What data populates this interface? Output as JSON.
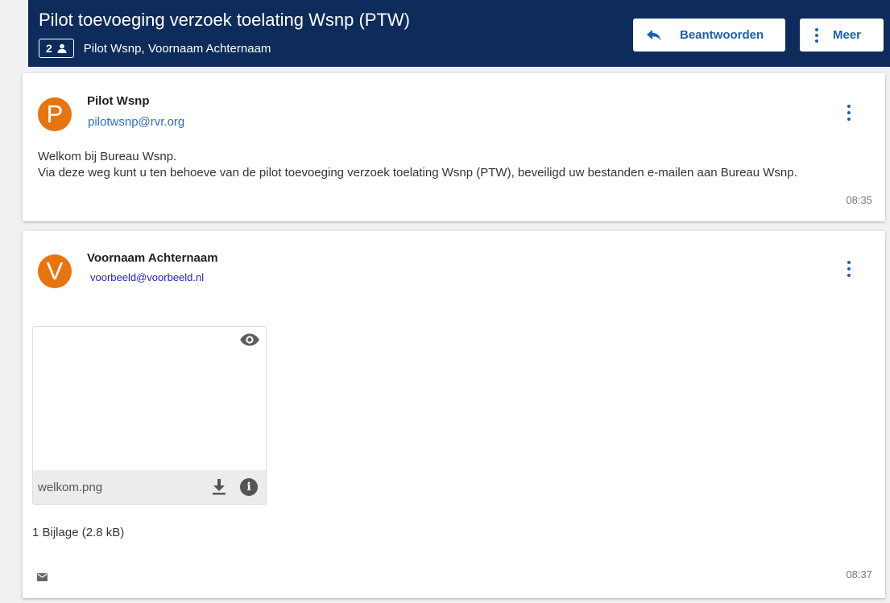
{
  "header": {
    "subject": "Pilot toevoeging verzoek toelating Wsnp (PTW)",
    "participant_count": "2",
    "participants": "Pilot Wsnp, Voornaam Achternaam",
    "reply_label": "Beantwoorden",
    "more_label": "Meer"
  },
  "messages": [
    {
      "avatar_letter": "P",
      "sender_name": "Pilot Wsnp",
      "sender_email": "pilotwsnp@rvr.org",
      "body_line1": "Welkom bij Bureau Wsnp.",
      "body_line2": "Via deze weg kunt u ten behoeve van de pilot toevoeging verzoek toelating Wsnp (PTW), beveiligd uw bestanden e-mailen aan Bureau Wsnp.",
      "time": "08:35"
    },
    {
      "avatar_letter": "V",
      "sender_name": "Voornaam Achternaam",
      "sender_email": "voorbeeld@voorbeeld.nl",
      "attachment_name": "welkom.png",
      "attachment_summary": "1 Bijlage (2.8 kB)",
      "time": "08:37"
    }
  ],
  "colors": {
    "header_bg": "#0e2c5b",
    "accent": "#1a5fb4",
    "avatar": "#e8740f"
  },
  "icons": [
    "person-icon",
    "reply-icon",
    "more-vert-icon",
    "eye-icon",
    "download-icon",
    "info-icon",
    "mail-icon"
  ]
}
